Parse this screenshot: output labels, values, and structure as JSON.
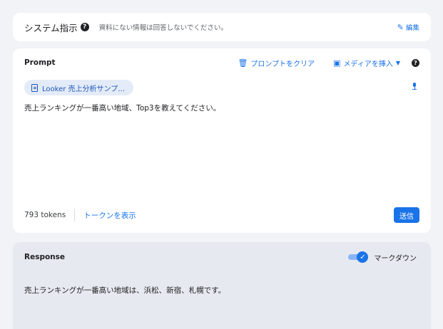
{
  "system": {
    "title": "システム指示",
    "help_icon": "help-icon",
    "placeholder_text": "資料にない情報は回答しないでください。",
    "edit_label": "編集",
    "edit_icon": "pencil-icon"
  },
  "prompt": {
    "label": "Prompt",
    "clear_label": "プロンプトをクリア",
    "clear_icon": "trash-icon",
    "insert_media_label": "メディアを挿入",
    "insert_media_icon": "image-add-icon",
    "chip_label": "Looker 売上分析サンプ…",
    "chip_icon": "document-icon",
    "text": "売上ランキングが一番高い地域、Top3を教えてください。",
    "token_count": "793 tokens",
    "show_tokens_label": "トークンを表示",
    "send_label": "送信"
  },
  "response": {
    "label": "Response",
    "markdown_label": "マークダウン",
    "markdown_on": true,
    "text": "売上ランキングが一番高い地域は、浜松、新宿、札幌です。"
  },
  "colors": {
    "accent": "#1a73e8",
    "background": "#f1f3f7",
    "response_bg": "#e6e9ef"
  }
}
